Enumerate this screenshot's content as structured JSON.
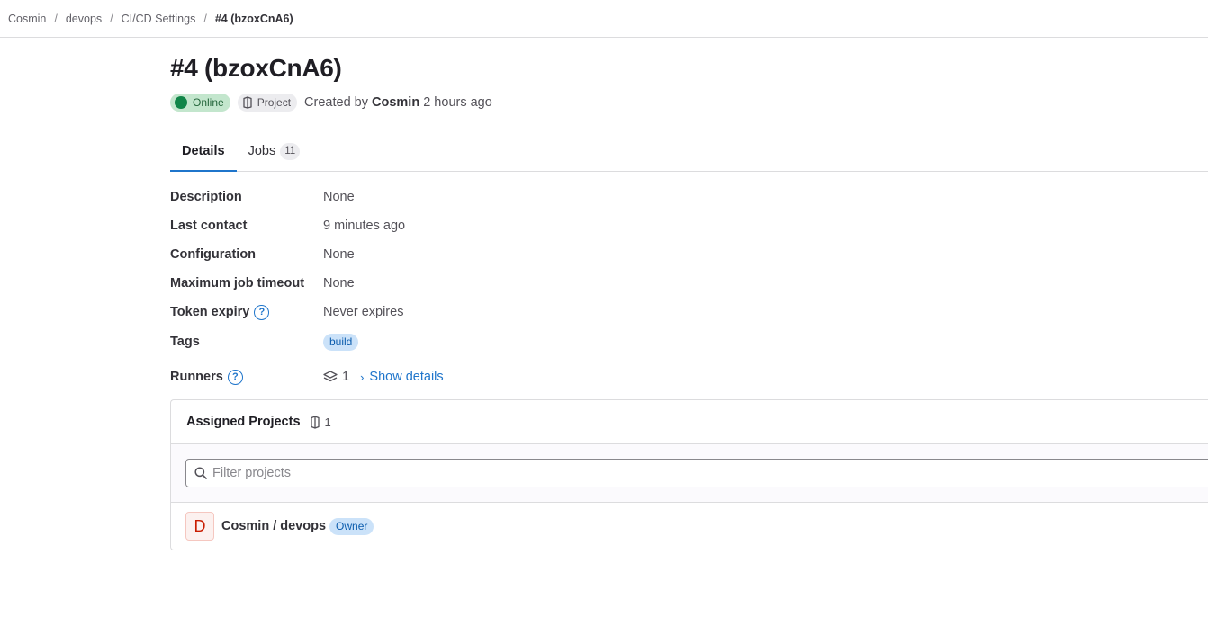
{
  "breadcrumb": {
    "items": [
      "Cosmin",
      "devops",
      "CI/CD Settings"
    ],
    "separator": "/",
    "current": "#4 (bzoxCnA6)"
  },
  "runner": {
    "title": "#4 (bzoxCnA6)",
    "status_badge": "Online",
    "type_badge": "Project",
    "created_prefix": "Created by",
    "created_by": "Cosmin",
    "created_when": "2 hours ago"
  },
  "tabs": [
    {
      "label": "Details",
      "active": true
    },
    {
      "label": "Jobs",
      "count": "11"
    }
  ],
  "details": {
    "description": {
      "label": "Description",
      "value": "None"
    },
    "last_contact": {
      "label": "Last contact",
      "value": "9 minutes ago"
    },
    "configuration": {
      "label": "Configuration",
      "value": "None"
    },
    "max_timeout": {
      "label": "Maximum job timeout",
      "value": "None"
    },
    "token_expiry": {
      "label": "Token expiry",
      "value": "Never expires",
      "help_icon": "question-circle-icon"
    },
    "tags": {
      "label": "Tags",
      "values": [
        "build"
      ]
    },
    "runners": {
      "label": "Runners",
      "count": "1",
      "show_details": "Show details",
      "icon": "layers-icon"
    }
  },
  "assigned_projects": {
    "heading": "Assigned Projects",
    "count": "1",
    "filter_placeholder": "Filter projects",
    "projects": [
      {
        "avatar_letter": "D",
        "name": "Cosmin / devops",
        "role": "Owner"
      }
    ]
  },
  "colors": {
    "accent": "#1f75cb",
    "online_bg": "#c3e6cd",
    "online_dot": "#108548",
    "tag_bg": "#cbe2f9",
    "avatar_text": "#c91c00"
  }
}
